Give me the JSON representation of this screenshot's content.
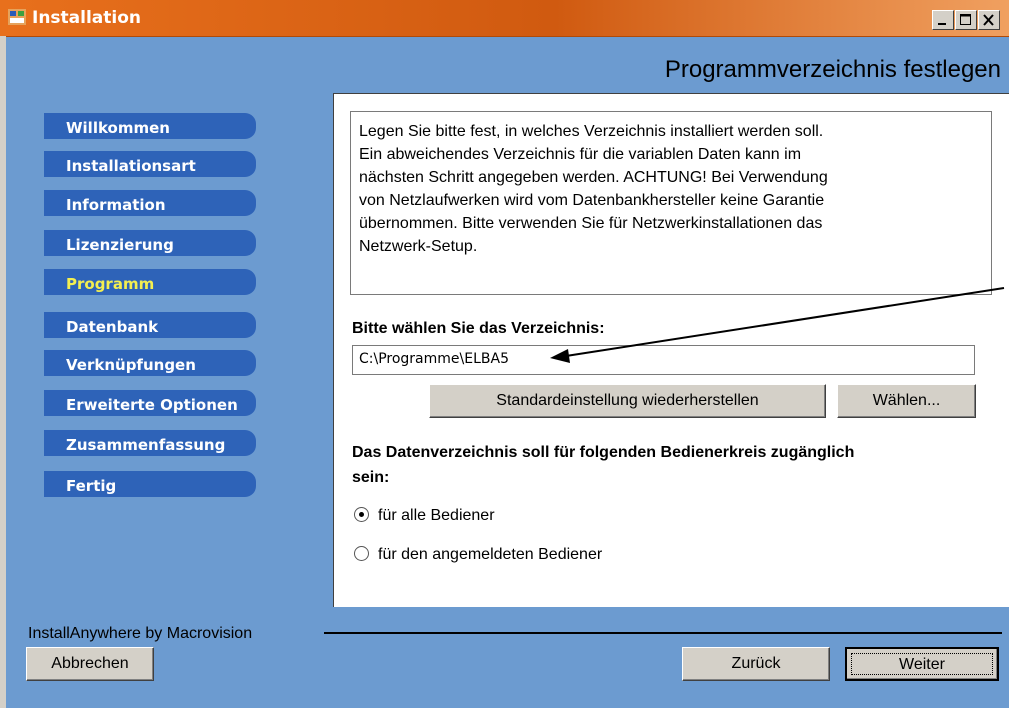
{
  "window": {
    "title": "Installation"
  },
  "heading": "Programmverzeichnis festlegen",
  "sidebar": {
    "items": [
      {
        "label": "Willkommen",
        "active": false
      },
      {
        "label": "Installationsart",
        "active": false
      },
      {
        "label": "Information",
        "active": false
      },
      {
        "label": "Lizenzierung",
        "active": false
      },
      {
        "label": "Programm",
        "active": true
      },
      {
        "label": "Datenbank",
        "active": false
      },
      {
        "label": "Verknüpfungen",
        "active": false
      },
      {
        "label": "Erweiterte Optionen",
        "active": false
      },
      {
        "label": "Zusammenfassung",
        "active": false
      },
      {
        "label": "Fertig",
        "active": false
      }
    ]
  },
  "main": {
    "info_lines": [
      "Legen Sie bitte fest, in welches Verzeichnis installiert werden soll.",
      "Ein abweichendes Verzeichnis für die variablen Daten kann im",
      "nächsten Schritt angegeben werden. ACHTUNG! Bei Verwendung",
      "von Netzlaufwerken wird vom Datenbankhersteller keine Garantie",
      "übernommen. Bitte verwenden Sie für Netzwerkinstallationen das",
      "Netzwerk-Setup."
    ],
    "dir_label": "Bitte wählen Sie das Verzeichnis:",
    "dir_value": "C:\\Programme\\ELBA5",
    "restore_button": "Standardeinstellung wiederherstellen",
    "choose_button": "Wählen...",
    "access_label_line1": "Das Datenverzeichnis soll für folgenden Bedienerkreis zugänglich",
    "access_label_line2": "sein:",
    "radio_all": "für alle Bediener",
    "radio_current": "für den angemeldeten Bediener",
    "selected_radio": "all"
  },
  "footer": {
    "vendor": "InstallAnywhere by Macrovision",
    "cancel": "Abbrechen",
    "back": "Zurück",
    "next": "Weiter"
  },
  "colors": {
    "background": "#6c9bd0",
    "nav_item": "#2e63b8",
    "nav_active_text": "#f4ef50",
    "titlebar": "#d05a10"
  }
}
